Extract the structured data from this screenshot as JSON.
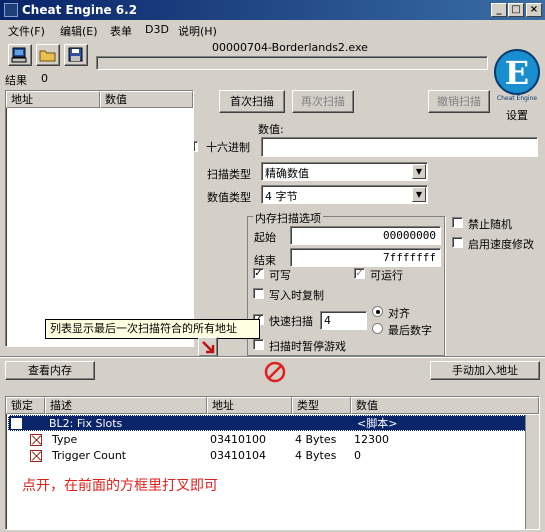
{
  "window": {
    "title": "Cheat Engine 6.2",
    "controls": {
      "minimize": "_",
      "maximize": "□",
      "close": "×"
    }
  },
  "menu": [
    "文件(F)",
    "编辑(E)",
    "表单",
    "D3D",
    "说明(H)"
  ],
  "process_name": "00000704-Borderlands2.exe",
  "results": {
    "label": "结果",
    "count": "0"
  },
  "address_list": {
    "col_address": "地址",
    "col_value": "数值"
  },
  "logo": {
    "letter": "E",
    "brand": "Cheat Engine",
    "settings_label": "设置"
  },
  "scan": {
    "first_scan": "首次扫描",
    "next_scan": "再次扫描",
    "undo_scan": "撤销扫描",
    "value_label": "数值:",
    "value": "",
    "hex_label": "十六进制",
    "scan_type_label": "扫描类型",
    "scan_type": "精确数值",
    "value_type_label": "数值类型",
    "value_type": "4 字节"
  },
  "memory_options": {
    "title": "内存扫描选项",
    "start_label": "起始",
    "start": "00000000",
    "stop_label": "结束",
    "stop": "7fffffff",
    "writable": "可写",
    "executable": "可运行",
    "copy_on_write": "写入时复制",
    "fast_scan": "快速扫描",
    "fast_scan_value": "4",
    "align": "对齐",
    "last_digits": "最后数字",
    "pause_game": "扫描时暂停游戏"
  },
  "right_options": {
    "no_random": "禁止随机",
    "speedhack": "启用速度修改"
  },
  "tooltip": "列表显示最后一次扫描符合的所有地址",
  "view_memory": "查看内存",
  "add_address": "手动加入地址",
  "cheat_table": {
    "columns": [
      "锁定",
      "描述",
      "地址",
      "类型",
      "数值"
    ],
    "rows": [
      {
        "description": "BL2: Fix Slots",
        "address": "",
        "type": "",
        "value": "<脚本>",
        "selected": true
      },
      {
        "description": "Type",
        "address": "03410100",
        "type": "4 Bytes",
        "value": "12300"
      },
      {
        "description": "Trigger Count",
        "address": "03410104",
        "type": "4 Bytes",
        "value": "0"
      }
    ]
  },
  "annotation": "点开，在前面的方框里打叉即可",
  "colors": {
    "title_bar": "#0a246a",
    "selection": "#0a246a",
    "annotation": "#e0201c",
    "logo": "#1a8fd0"
  }
}
